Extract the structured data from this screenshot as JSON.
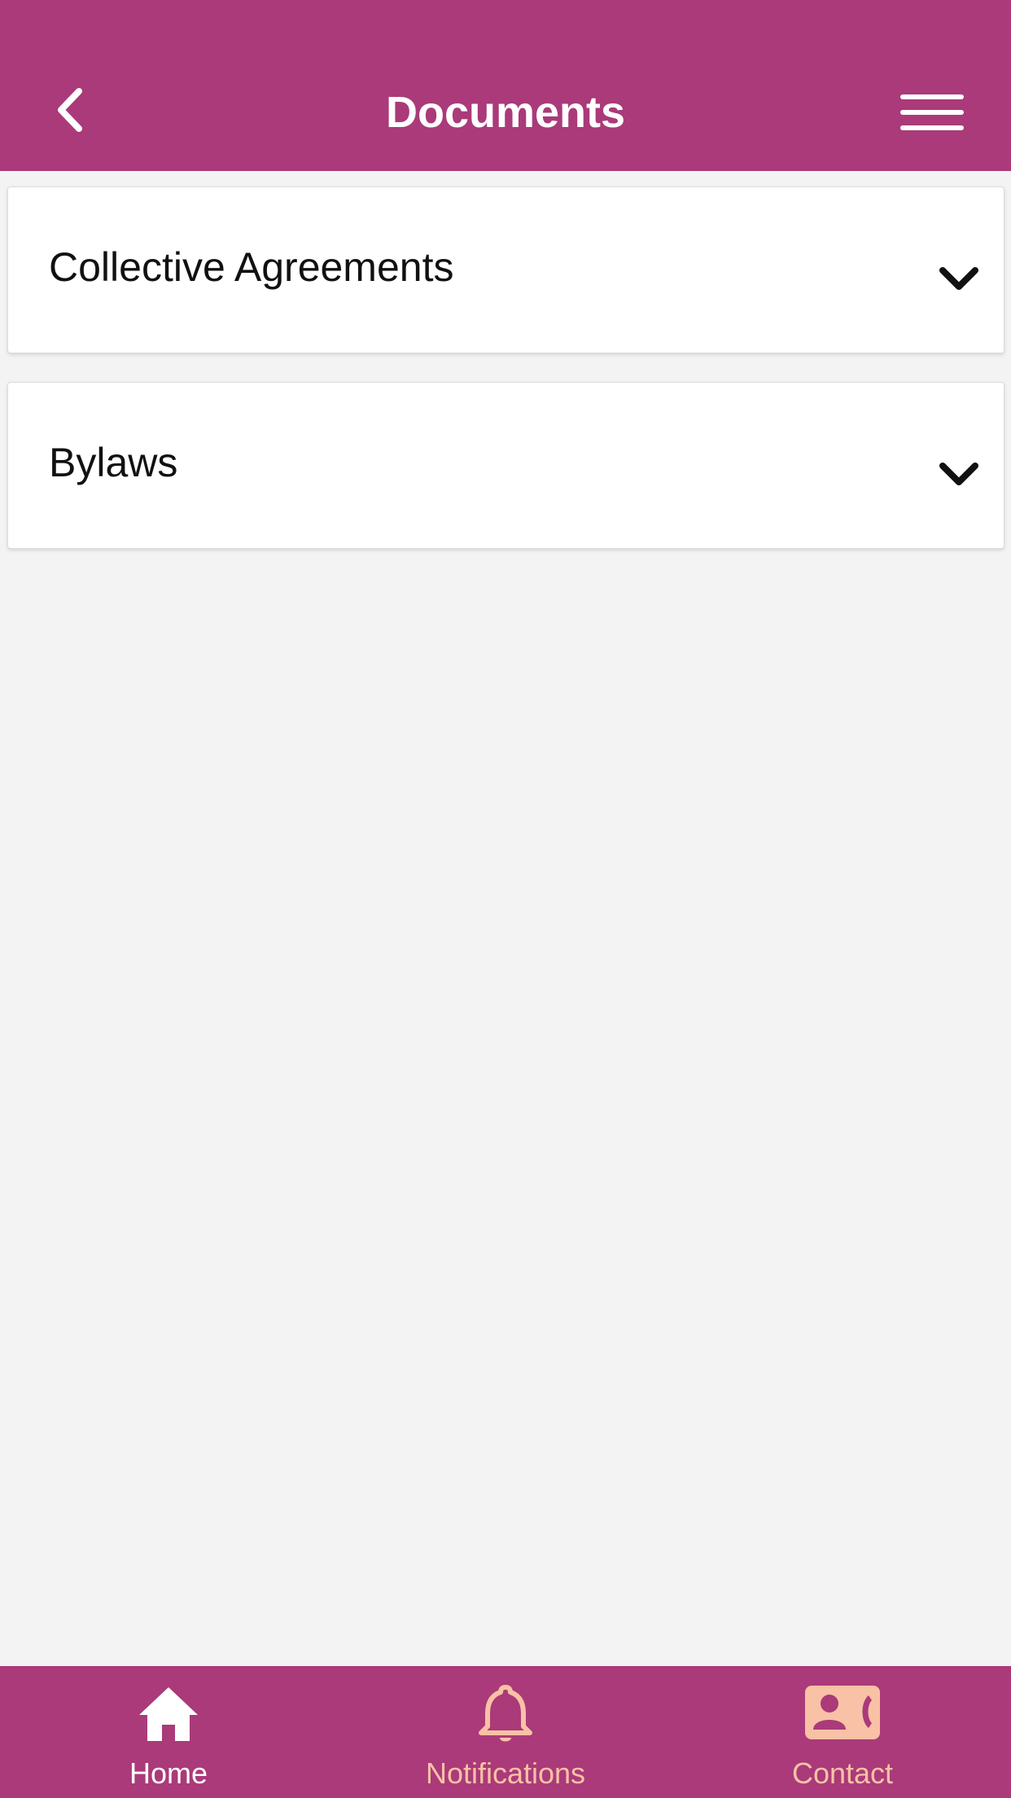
{
  "header": {
    "title": "Documents",
    "back_icon": "chevron-left-icon",
    "menu_icon": "hamburger-menu-icon"
  },
  "sections": [
    {
      "label": "Collective Agreements",
      "icon": "chevron-down-icon"
    },
    {
      "label": "Bylaws",
      "icon": "chevron-down-icon"
    }
  ],
  "tabbar": {
    "tabs": [
      {
        "label": "Home",
        "icon": "home-icon",
        "active": true
      },
      {
        "label": "Notifications",
        "icon": "bell-icon",
        "active": false
      },
      {
        "label": "Contact",
        "icon": "contact-card-icon",
        "active": false
      }
    ]
  },
  "colors": {
    "primary": "#aa3a79",
    "background": "#f3f3f3",
    "tab_active": "#ffffff",
    "tab_inactive": "#f9c1a6"
  }
}
